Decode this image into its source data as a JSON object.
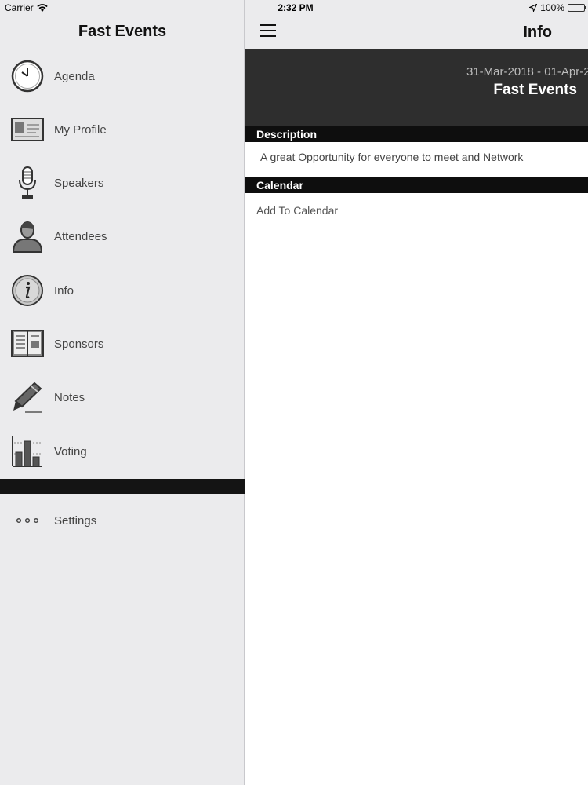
{
  "status_bar": {
    "carrier": "Carrier",
    "time": "2:32 PM",
    "battery": "100%",
    "battery_color": "#4cd964"
  },
  "sidebar": {
    "title": "Fast Events",
    "items": [
      {
        "label": "Agenda",
        "icon": "clock-icon"
      },
      {
        "label": "My Profile",
        "icon": "id-card-icon"
      },
      {
        "label": "Speakers",
        "icon": "microphone-icon"
      },
      {
        "label": "Attendees",
        "icon": "person-icon"
      },
      {
        "label": "Info",
        "icon": "info-icon"
      },
      {
        "label": "Sponsors",
        "icon": "book-icon"
      },
      {
        "label": "Notes",
        "icon": "pen-icon"
      },
      {
        "label": "Voting",
        "icon": "bar-chart-icon"
      }
    ],
    "settings": {
      "label": "Settings",
      "icon": "more-dots-icon"
    }
  },
  "navbar": {
    "title": "Info",
    "menu_icon": "hamburger-icon"
  },
  "hero": {
    "dates": "31-Mar-2018 - 01-Apr-2",
    "event_name": "Fast Events",
    "background": "#2e2e2e"
  },
  "description": {
    "header": "Description",
    "text": "A great Opportunity for everyone to meet and Network"
  },
  "calendar": {
    "header": "Calendar",
    "action": "Add To Calendar"
  }
}
